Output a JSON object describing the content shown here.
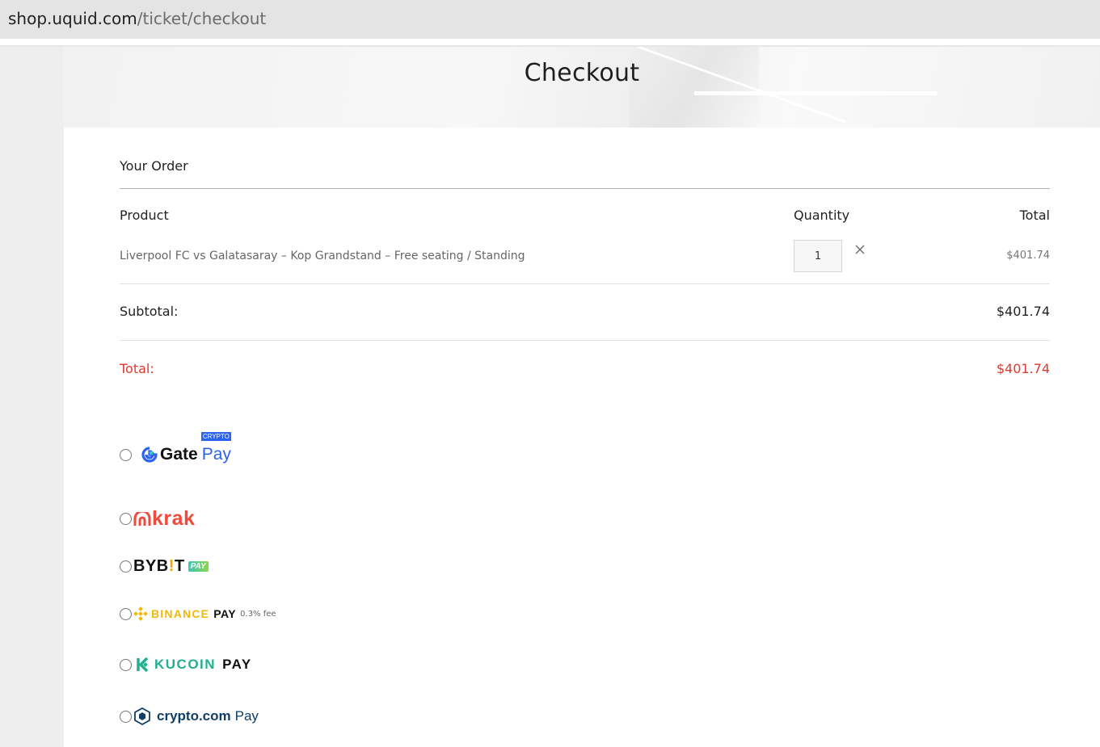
{
  "browser": {
    "url_host": "shop.uquid.com",
    "url_path": "/ticket/checkout"
  },
  "page": {
    "title": "Checkout"
  },
  "order": {
    "heading": "Your Order",
    "columns": {
      "product": "Product",
      "quantity": "Quantity",
      "total": "Total"
    },
    "items": [
      {
        "name": "Liverpool FC vs Galatasaray – Kop Grandstand – Free seating / Standing",
        "quantity": "1",
        "remove_icon": "close-icon",
        "total": "$401.74"
      }
    ],
    "subtotal_label": "Subtotal:",
    "subtotal_value": "$401.74",
    "total_label": "Total:",
    "total_value": "$401.74",
    "total_color": "#e0372f"
  },
  "payment_methods": [
    {
      "id": "gate",
      "brand": "Gate",
      "suffix": "Pay",
      "badge": "CRYPTO",
      "brand_color": "#2b63ee"
    },
    {
      "id": "krak",
      "brand": "krak",
      "brand_color": "#f04a3c"
    },
    {
      "id": "bybit",
      "brand_before": "BYB",
      "brand_i": "!",
      "brand_after": "T",
      "badge": "PAY"
    },
    {
      "id": "binance",
      "brand": "BINANCE",
      "suffix": "PAY",
      "note": "0.3% fee",
      "brand_color": "#f0b90b"
    },
    {
      "id": "kucoin",
      "brand": "KUCOIN",
      "suffix": "PAY",
      "brand_color": "#23af91"
    },
    {
      "id": "cryptocom",
      "brand": "crypto.com",
      "suffix": "Pay",
      "brand_color": "#103f68"
    }
  ]
}
